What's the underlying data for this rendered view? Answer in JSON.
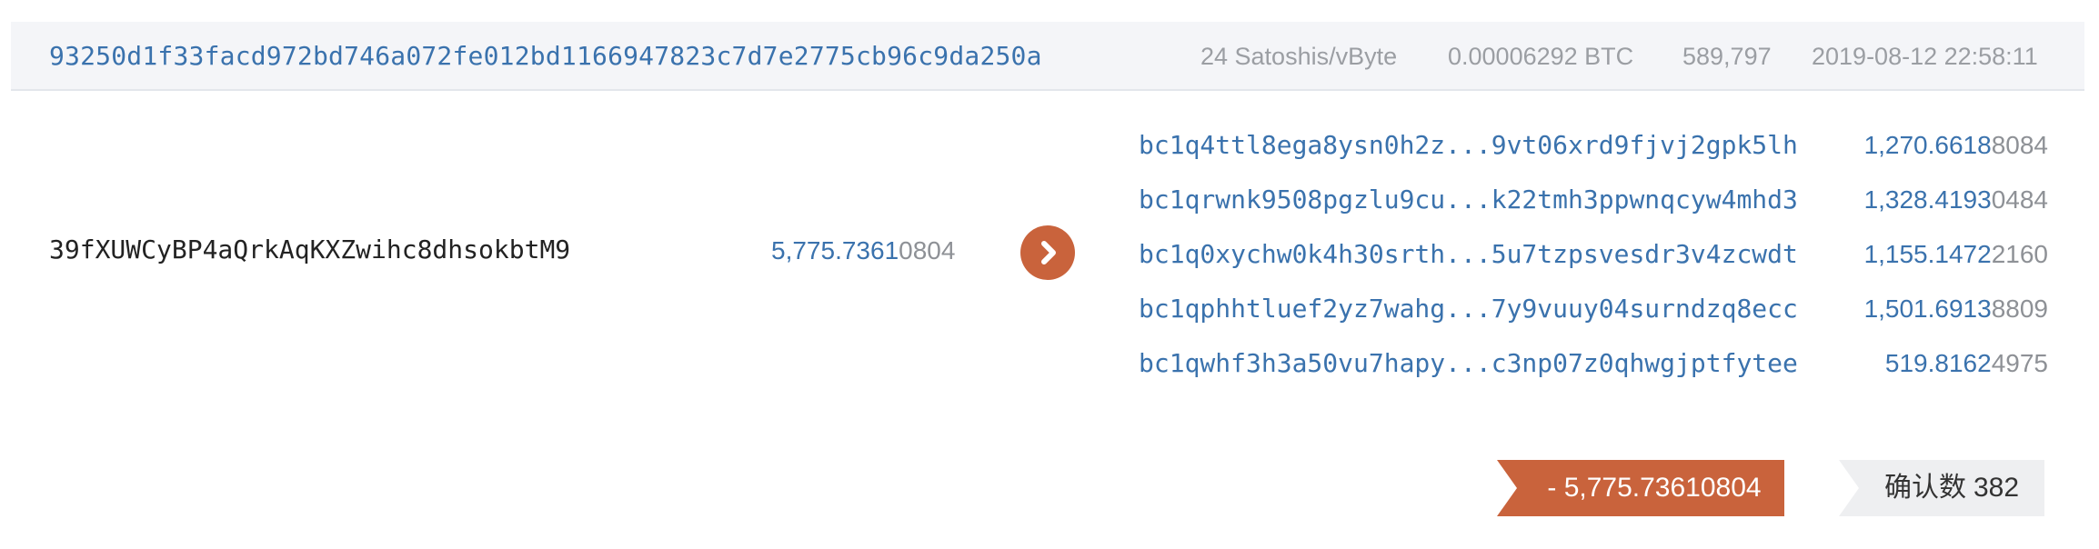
{
  "transaction": {
    "hash": "93250d1f33facd972bd746a072fe012bd1166947823c7d7e2775cb96c9da250a",
    "fee_rate": "24 Satoshis/vByte",
    "fee": "0.00006292 BTC",
    "block_height": "589,797",
    "timestamp": "2019-08-12 22:58:11"
  },
  "input": {
    "address": "39fXUWCyBP4aQrkAqKXZwihc8dhsokbtM9",
    "amount_major": "5,775.7361",
    "amount_minor": "0804"
  },
  "outputs": [
    {
      "address": "bc1q4ttl8ega8ysn0h2z...9vt06xrd9fjvj2gpk5lh",
      "amount_major": "1,270.6618",
      "amount_minor": "8084"
    },
    {
      "address": "bc1qrwnk9508pgzlu9cu...k22tmh3ppwnqcyw4mhd3",
      "amount_major": "1,328.4193",
      "amount_minor": "0484"
    },
    {
      "address": "bc1q0xychw0k4h30srth...5u7tzpsvesdr3v4zcwdt",
      "amount_major": "1,155.1472",
      "amount_minor": "2160"
    },
    {
      "address": "bc1qphhtluef2yz7wahg...7y9vuuy04surndzq8ecc",
      "amount_major": "1,501.6913",
      "amount_minor": "8809"
    },
    {
      "address": "bc1qwhf3h3a50vu7hapy...c3np07z0qhwgjptfytee",
      "amount_major": "519.8162",
      "amount_minor": "4975"
    }
  ],
  "total": "- 5,775.73610804",
  "confirmations": {
    "label": "确认数",
    "count": "382"
  },
  "colors": {
    "link_blue": "#3a72ad",
    "accent_orange": "#c9633c",
    "muted_gray": "#9b9ea3",
    "header_bg": "#f4f5f8",
    "badge_gray": "#eeeff1"
  },
  "icons": {
    "arrow": "chevron-right-icon"
  }
}
